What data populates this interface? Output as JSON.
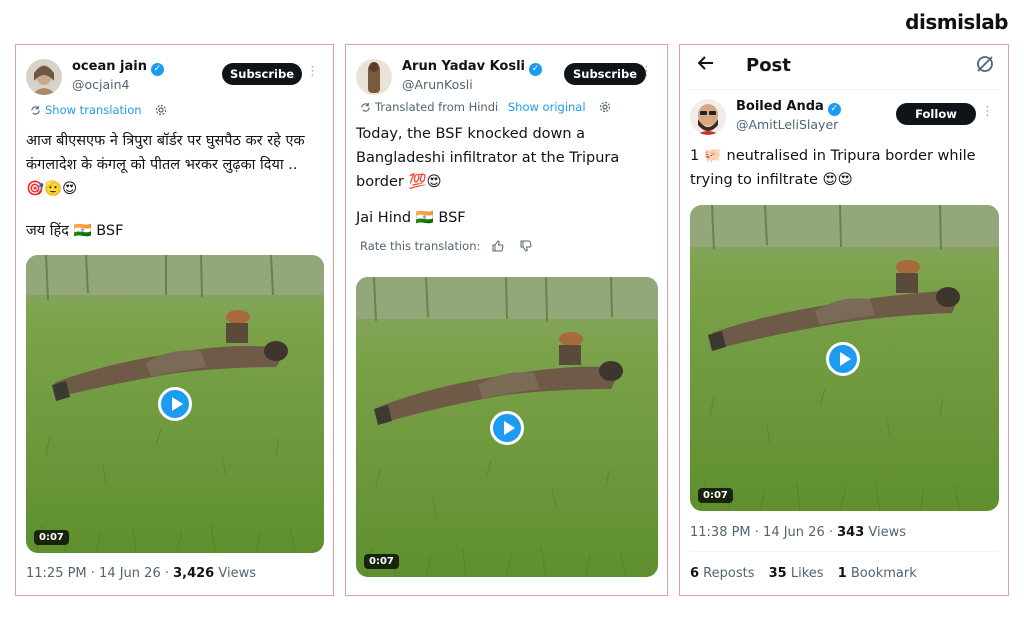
{
  "brand": {
    "logo_text": "dismislab"
  },
  "tweet1": {
    "name": "ocean jain",
    "handle": "@ocjain4",
    "action_label": "Subscribe",
    "translate_link": "Show translation",
    "text_line1": "आज बीएसएफ ने त्रिपुरा बॉर्डर पर घुसपैठ कर रहे एक",
    "text_line2": "कंगलादेश के कंगलू को पीतल भरकर लुढ़का दिया ..",
    "text_line3": "🎯🫡😍",
    "text_line4": "जय हिंद 🇮🇳 BSF",
    "duration": "0:07",
    "timestamp": "11:25 PM · 14 Jun 26 · ",
    "views_count": "3,426",
    "views_label": " Views"
  },
  "tweet2": {
    "name": "Arun Yadav Kosli",
    "handle": "@ArunKosli",
    "action_label": "Subscribe",
    "translated_from": "Translated from Hindi",
    "show_original": "Show original",
    "text_line1": "Today, the BSF knocked down a",
    "text_line2": "Bangladeshi infiltrator at the Tripura",
    "text_line3": "border 💯😍",
    "text_line4": "Jai Hind 🇮🇳 BSF",
    "rate_label": "Rate this translation:",
    "duration": "0:07"
  },
  "tweet3": {
    "page_title": "Post",
    "name": "Boiled Anda",
    "handle": "@AmitLeliSlayer",
    "action_label": "Follow",
    "text_line1": "1 🐖 neutralised in Tripura border while",
    "text_line2": "trying to infiltrate 😍😍",
    "duration": "0:07",
    "timestamp": "11:38 PM · 14 Jun 26 · ",
    "views_count": "343",
    "views_label": " Views",
    "reposts_count": "6",
    "reposts_label": " Reposts",
    "likes_count": "35",
    "likes_label": " Likes",
    "bookmarks_count": "1",
    "bookmarks_label": " Bookmark"
  },
  "colors": {
    "accent": "#1d9bf0",
    "card_border": "#e0a0a0",
    "button_bg": "#0f1419",
    "grass": "#6f9a3a"
  },
  "icons": [
    "verified-badge-icon",
    "more-dots-icon",
    "translate-icon",
    "gear-icon",
    "thumbs-up-icon",
    "thumbs-down-icon",
    "back-arrow-icon",
    "edit-disabled-icon",
    "play-icon"
  ]
}
